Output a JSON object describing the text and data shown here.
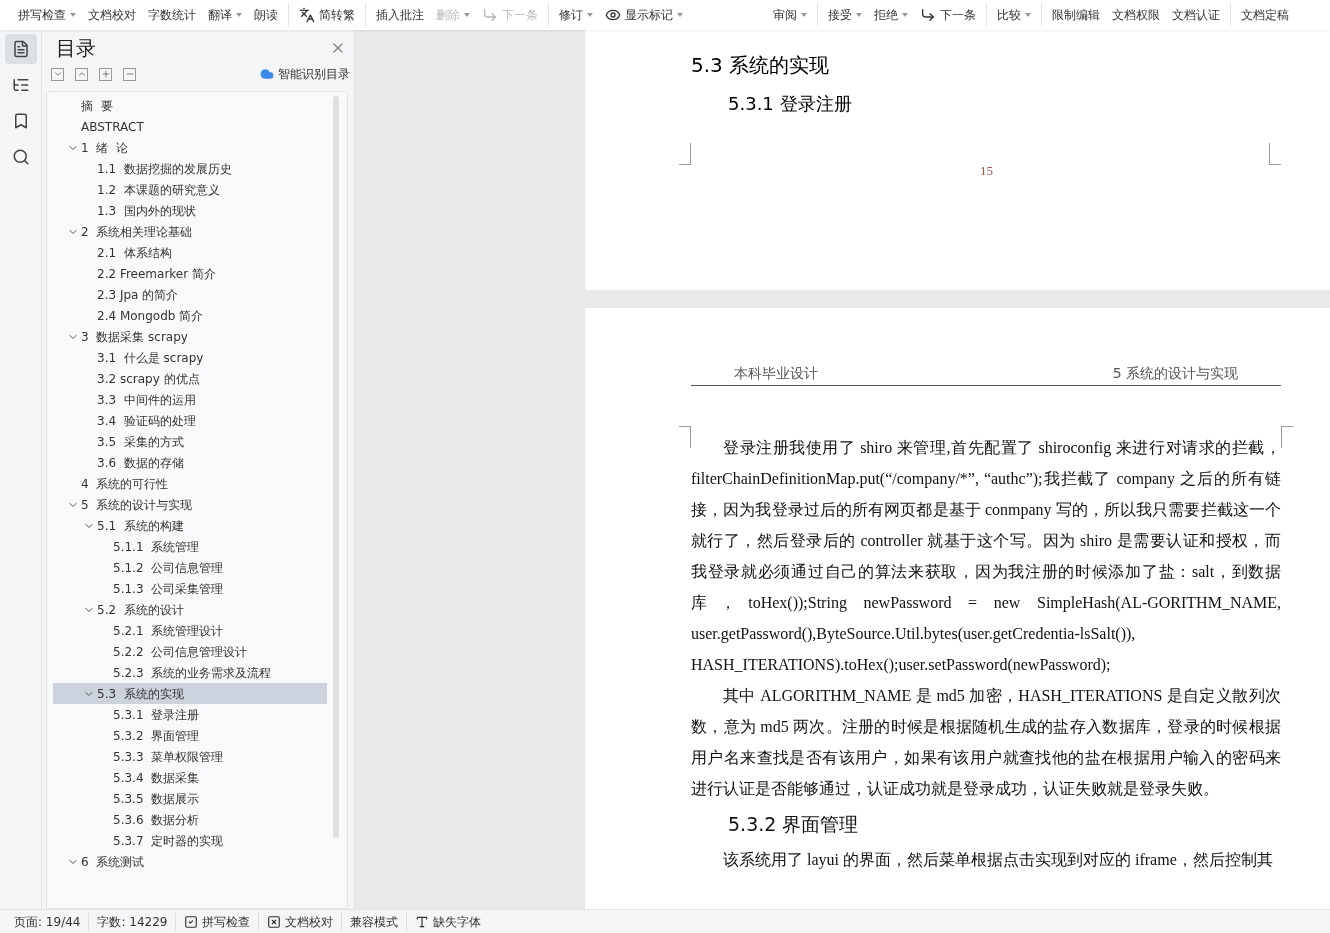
{
  "toolbar": {
    "groups": [
      [
        {
          "label": "拼写检查",
          "kind": "dropdown",
          "disabled": false
        },
        {
          "label": "文档校对",
          "kind": "plain",
          "disabled": false
        },
        {
          "label": "字数统计",
          "kind": "plain",
          "disabled": false
        },
        {
          "label": "翻译",
          "kind": "dropdown",
          "disabled": false
        },
        {
          "label": "朗读",
          "kind": "plain",
          "disabled": false
        }
      ],
      [
        {
          "label": "简转繁",
          "kind": "convert",
          "disabled": false
        }
      ],
      [
        {
          "label": "插入批注",
          "kind": "plain",
          "disabled": false
        },
        {
          "label": "删除",
          "kind": "dropdown",
          "disabled": true
        },
        {
          "label": "下一条",
          "kind": "next",
          "disabled": true
        }
      ],
      [
        {
          "label": "修订",
          "kind": "dropdown",
          "disabled": false
        },
        {
          "label": "显示标记",
          "kind": "markup",
          "disabled": false
        }
      ],
      [
        {
          "label": "审阅",
          "kind": "dropdown",
          "disabled": false
        }
      ],
      [
        {
          "label": "接受",
          "kind": "dropdown",
          "disabled": false
        },
        {
          "label": "拒绝",
          "kind": "dropdown",
          "disabled": false
        },
        {
          "label": "下一条",
          "kind": "next",
          "disabled": false
        }
      ],
      [
        {
          "label": "比较",
          "kind": "dropdown",
          "disabled": false
        }
      ],
      [
        {
          "label": "限制编辑",
          "kind": "plain",
          "disabled": false
        },
        {
          "label": "文档权限",
          "kind": "plain",
          "disabled": false
        },
        {
          "label": "文档认证",
          "kind": "plain",
          "disabled": false
        }
      ],
      [
        {
          "label": "文档定稿",
          "kind": "plain",
          "disabled": false
        }
      ]
    ]
  },
  "rail": [
    {
      "kind": "outline",
      "selected": true
    },
    {
      "kind": "tree",
      "selected": false
    },
    {
      "kind": "bookmark",
      "selected": false
    },
    {
      "kind": "search",
      "selected": false
    }
  ],
  "outline": {
    "title": "目录",
    "smart_link": "智能识别目录",
    "items": [
      {
        "label": "摘  要",
        "selected": false
      },
      {
        "label": "ABSTRACT",
        "selected": false
      },
      {
        "label": "1  绪  论",
        "selected": false,
        "expanded": true,
        "children": [
          {
            "label": "1.1  数据挖掘的发展历史",
            "selected": false
          },
          {
            "label": "1.2  本课题的研究意义",
            "selected": false
          },
          {
            "label": "1.3  国内外的现状",
            "selected": false
          }
        ]
      },
      {
        "label": "2  系统相关理论基础",
        "selected": false,
        "expanded": true,
        "children": [
          {
            "label": "2.1  体系结构",
            "selected": false
          },
          {
            "label": "2.2 Freemarker 简介",
            "selected": false
          },
          {
            "label": "2.3 Jpa 的简介",
            "selected": false
          },
          {
            "label": "2.4 Mongodb 简介",
            "selected": false
          }
        ]
      },
      {
        "label": "3  数据采集 scrapy",
        "selected": false,
        "expanded": true,
        "children": [
          {
            "label": "3.1  什么是 scrapy",
            "selected": false
          },
          {
            "label": "3.2 scrapy 的优点",
            "selected": false
          },
          {
            "label": "3.3  中间件的运用",
            "selected": false
          },
          {
            "label": "3.4  验证码的处理",
            "selected": false
          },
          {
            "label": "3.5  采集的方式",
            "selected": false
          },
          {
            "label": "3.6  数据的存储",
            "selected": false
          }
        ]
      },
      {
        "label": "4  系统的可行性",
        "selected": false
      },
      {
        "label": "5  系统的设计与实现",
        "selected": false,
        "expanded": true,
        "children": [
          {
            "label": "5.1  系统的构建",
            "selected": false,
            "expanded": true,
            "children": [
              {
                "label": "5.1.1  系统管理",
                "selected": false
              },
              {
                "label": "5.1.2  公司信息管理",
                "selected": false
              },
              {
                "label": "5.1.3  公司采集管理",
                "selected": false
              }
            ]
          },
          {
            "label": "5.2  系统的设计",
            "selected": false,
            "expanded": true,
            "children": [
              {
                "label": "5.2.1  系统管理设计",
                "selected": false
              },
              {
                "label": "5.2.2  公司信息管理设计",
                "selected": false
              },
              {
                "label": "5.2.3  系统的业务需求及流程",
                "selected": false
              }
            ]
          },
          {
            "label": "5.3  系统的实现",
            "selected": true,
            "expanded": true,
            "children": [
              {
                "label": "5.3.1  登录注册",
                "selected": false
              },
              {
                "label": "5.3.2  界面管理",
                "selected": false
              },
              {
                "label": "5.3.3  菜单权限管理",
                "selected": false
              },
              {
                "label": "5.3.4  数据采集",
                "selected": false
              },
              {
                "label": "5.3.5  数据展示",
                "selected": false
              },
              {
                "label": "5.3.6  数据分析",
                "selected": false
              },
              {
                "label": "5.3.7  定时器的实现",
                "selected": false
              }
            ]
          }
        ]
      },
      {
        "label": "6  系统测试",
        "selected": false,
        "expanded": true
      }
    ]
  },
  "page1": {
    "heading": "5.3  系统的实现",
    "subheading": "5.3.1  登录注册",
    "page_number": "15"
  },
  "page2": {
    "header_left": "本科毕业设计",
    "header_right": "5  系统的设计与实现",
    "blocks": [
      {
        "kind": "paragraph",
        "text": "登录注册我使用了 shiro 来管理,首先配置了 shiroconfig 来进行对请求的拦截，filterChainDefinitionMap.put(“/company/*”, “authc”);我拦截了 company 之后的所有链接，因为我登录过后的所有网页都是基于 conmpany 写的，所以我只需要拦截这一个就行了，然后登录后的 controller 就基于这个写。因为 shiro 是需要认证和授权，而我登录就必须通过自己的算法来获取，因为我注册的时候添加了盐：salt，到数据库，toHex());String newPassword = new SimpleHash(AL-GORITHM_NAME, user.getPassword(),ByteSource.Util.bytes(user.getCredentia-lsSalt()), HASH_ITERATIONS).toHex();user.setPassword(newPassword);"
      },
      {
        "kind": "paragraph",
        "text": "其中 ALGORITHM_NAME 是 md5 加密，HASH_ITERATIONS 是自定义散列次数，意为 md5 两次。注册的时候是根据随机生成的盐存入数据库，登录的时候根据用户名来查找是否有该用户，如果有该用户就查找他的盐在根据用户输入的密码来进行认证是否能够通过，认证成功就是登录成功，认证失败就是登录失败。"
      },
      {
        "kind": "heading",
        "text": "5.3.2  界面管理"
      },
      {
        "kind": "paragraph",
        "text": "该系统用了 layui 的界面，然后菜单根据点击实现到对应的 iframe，然后控制其"
      }
    ]
  },
  "status_bar": [
    {
      "kind": "text",
      "label": "页面: 19/44"
    },
    {
      "kind": "text",
      "label": "字数: 14229"
    },
    {
      "kind": "spell",
      "label": "拼写检查"
    },
    {
      "kind": "proof",
      "label": "文档校对"
    },
    {
      "kind": "text",
      "label": "兼容模式"
    },
    {
      "kind": "font",
      "label": "缺失字体"
    }
  ]
}
